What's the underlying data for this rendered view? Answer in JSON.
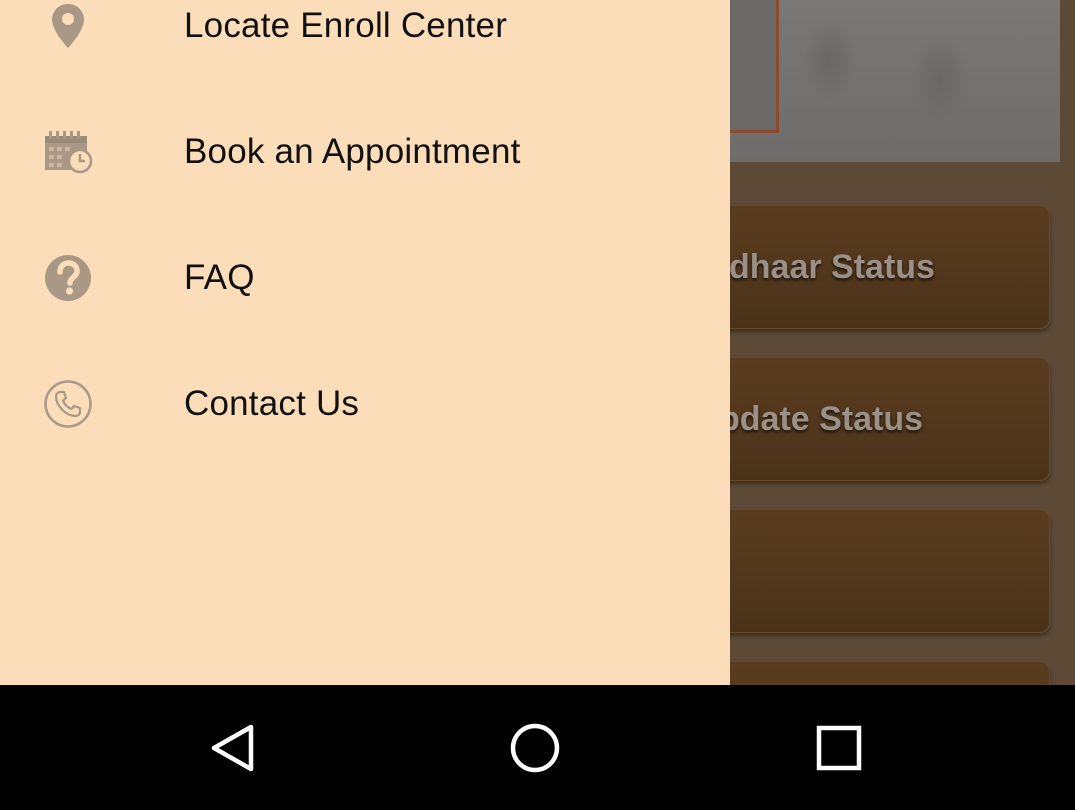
{
  "drawer": {
    "items": [
      {
        "label": "Locate Enroll Center",
        "icon": "location-pin-icon"
      },
      {
        "label": "Book an Appointment",
        "icon": "calendar-icon"
      },
      {
        "label": "FAQ",
        "icon": "help-icon"
      },
      {
        "label": "Contact Us",
        "icon": "phone-icon"
      }
    ]
  },
  "background": {
    "buttons": [
      {
        "label": "dhaar Status"
      },
      {
        "label": "pdate Status"
      },
      {
        "label": ""
      }
    ]
  },
  "system_nav": {
    "back": "back-icon",
    "home": "home-icon",
    "recents": "recents-icon"
  },
  "colors": {
    "drawer_bg": "#fcddb9",
    "icon": "#a99886",
    "scrim_bg": "#5c4a37"
  }
}
